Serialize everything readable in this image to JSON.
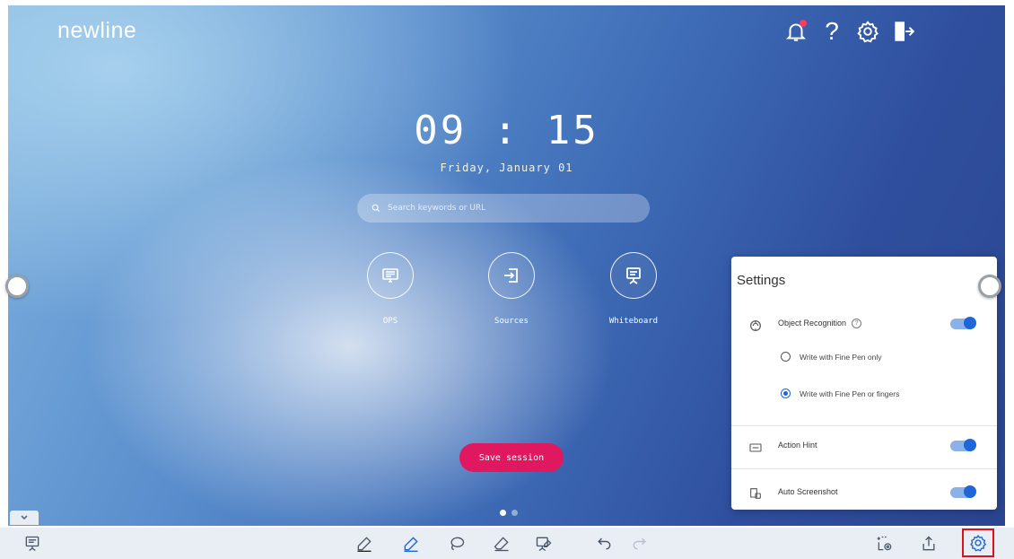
{
  "brand": {
    "logo_text": "newline"
  },
  "top_bar": {
    "notification_icon": "bell-icon",
    "help_label": "?",
    "settings_icon": "gear-icon",
    "exit_icon": "exit-icon"
  },
  "home": {
    "time": "09 : 15",
    "date": "Friday, January 01",
    "search_placeholder": "Search keywords or URL",
    "apps": [
      {
        "label": "OPS",
        "icon": "ops-icon"
      },
      {
        "label": "Sources",
        "icon": "sources-icon"
      },
      {
        "label": "Whiteboard",
        "icon": "whiteboard-icon"
      }
    ],
    "save_session_label": "Save session",
    "page_indicator": {
      "pages": 2,
      "active": 1
    }
  },
  "settings_panel": {
    "title": "Settings",
    "object_recognition": {
      "label": "Object Recognition",
      "enabled": true
    },
    "radio_options": [
      {
        "label": "Write with Fine Pen only",
        "selected": false
      },
      {
        "label": "Write with Fine Pen or fingers",
        "selected": true
      }
    ],
    "action_hint": {
      "label": "Action Hint",
      "enabled": true
    },
    "auto_screenshot": {
      "label": "Auto Screenshot",
      "enabled": true
    }
  },
  "toolbar": {
    "left": [
      "whiteboard-icon"
    ],
    "center": [
      "pen-icon",
      "fine-pen-icon",
      "lasso-icon",
      "eraser-icon",
      "screen-annotate-icon",
      "undo-icon",
      "redo-icon"
    ],
    "right": [
      "screenshot-icon",
      "share-icon",
      "settings-icon"
    ]
  },
  "colors": {
    "accent": "#1f66d8",
    "save_button": "#e0185f",
    "highlight": "#e0101a",
    "toolbar_bg": "#e9eef5"
  }
}
